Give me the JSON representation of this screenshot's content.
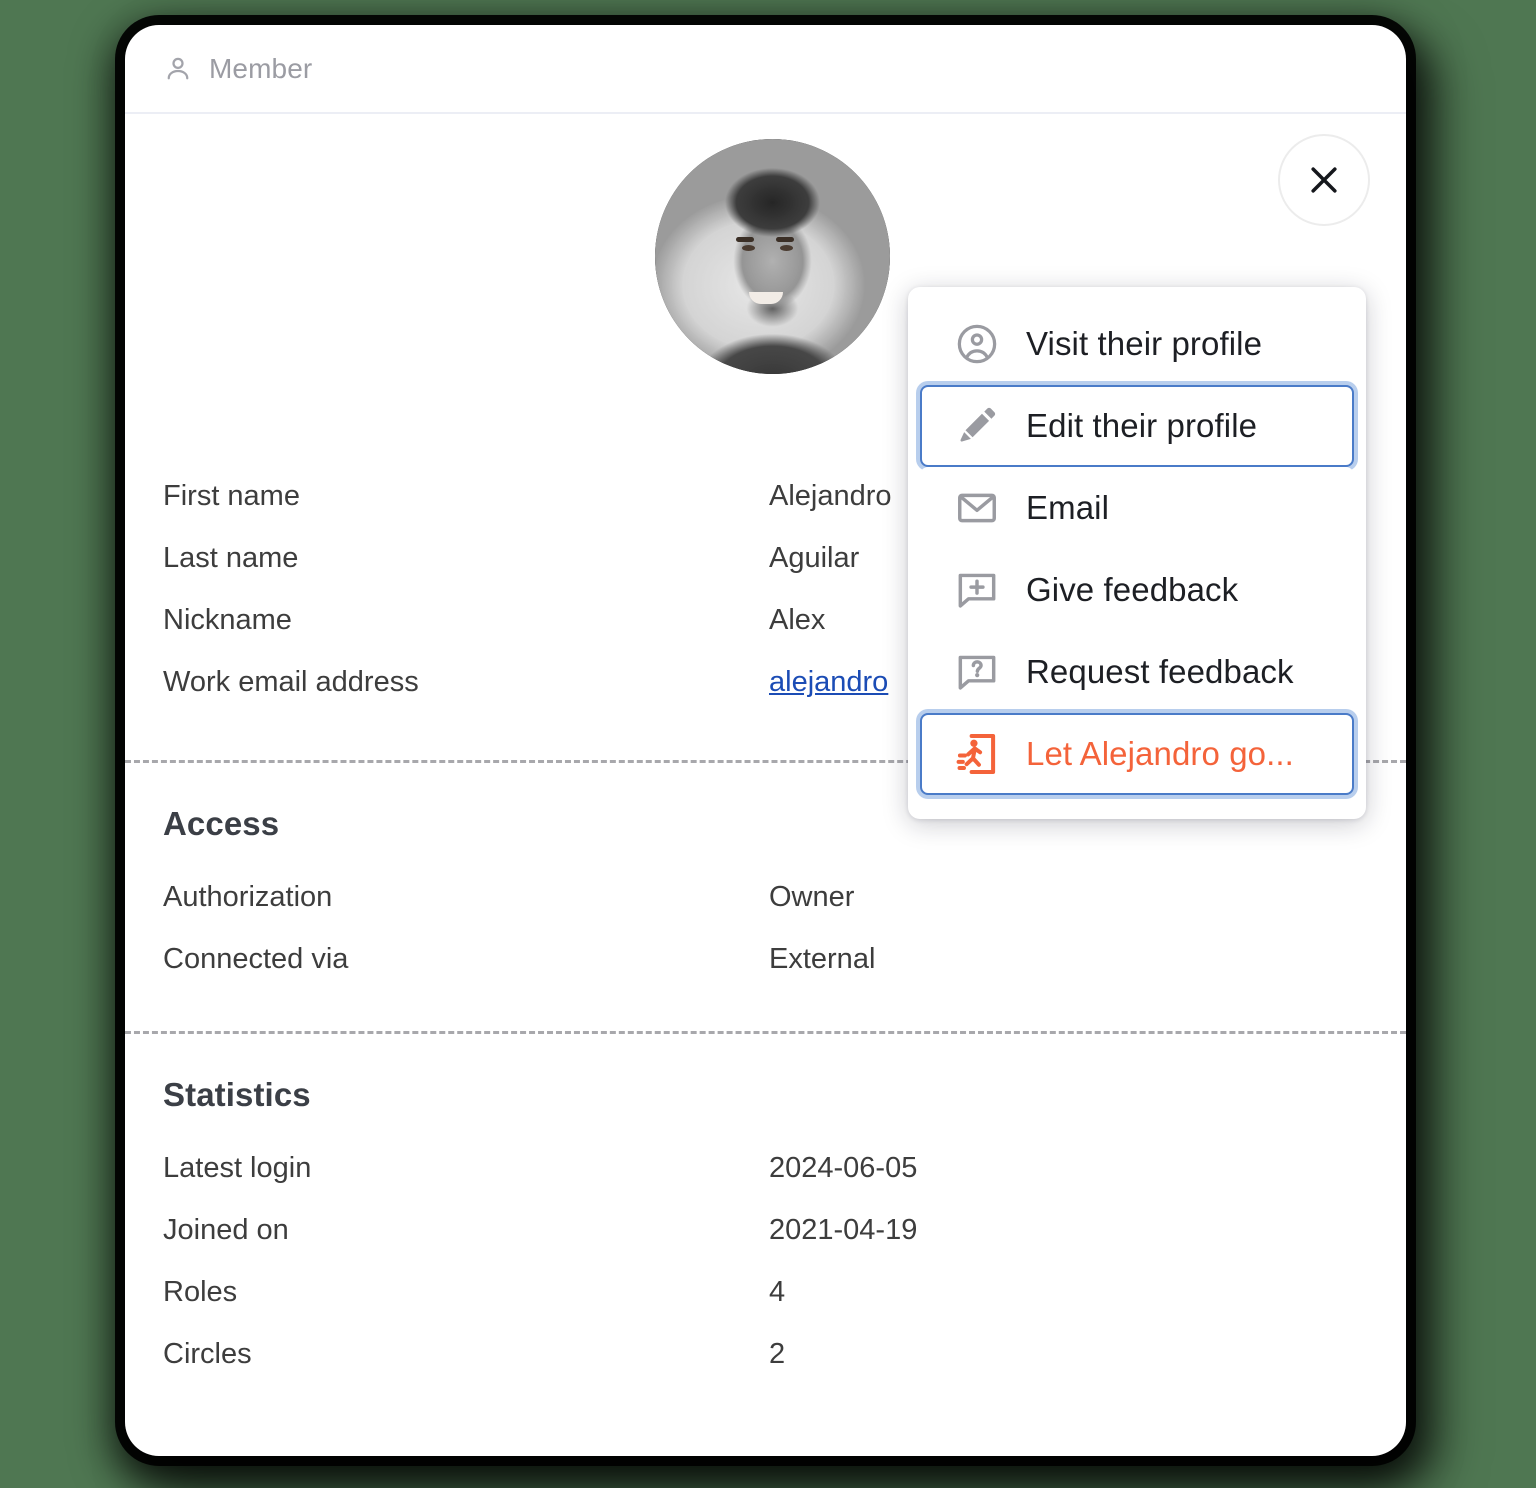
{
  "window": {
    "background_color": "#4f7752"
  },
  "header": {
    "icon": "person-icon",
    "title": "Member"
  },
  "avatar": {
    "alt": "member-avatar-photo"
  },
  "close_button": {
    "icon": "close-icon",
    "label": "Close"
  },
  "profile": {
    "fields": [
      {
        "label": "First name",
        "value": "Alejandro",
        "is_link": false
      },
      {
        "label": "Last name",
        "value": "Aguilar",
        "is_link": false
      },
      {
        "label": "Nickname",
        "value": "Alex",
        "is_link": false
      },
      {
        "label": "Work email address",
        "value": "alejandro",
        "is_link": true
      }
    ]
  },
  "access": {
    "title": "Access",
    "fields": [
      {
        "label": "Authorization",
        "value": "Owner"
      },
      {
        "label": "Connected via",
        "value": "External"
      }
    ]
  },
  "statistics": {
    "title": "Statistics",
    "fields": [
      {
        "label": "Latest login",
        "value": "2024-06-05"
      },
      {
        "label": "Joined on",
        "value": "2021-04-19"
      },
      {
        "label": "Roles",
        "value": "4"
      },
      {
        "label": "Circles",
        "value": "2"
      }
    ]
  },
  "action_menu": {
    "items": [
      {
        "label": "Visit their profile",
        "icon": "user-circle-icon",
        "focused": false,
        "danger": false
      },
      {
        "label": "Edit their profile",
        "icon": "pencil-icon",
        "focused": true,
        "danger": false
      },
      {
        "label": "Email",
        "icon": "envelope-icon",
        "focused": false,
        "danger": false
      },
      {
        "label": "Give feedback",
        "icon": "comment-plus-icon",
        "focused": false,
        "danger": false
      },
      {
        "label": "Request feedback",
        "icon": "comment-question-icon",
        "focused": false,
        "danger": false
      },
      {
        "label": "Let Alejandro go...",
        "icon": "exit-run-icon",
        "focused": true,
        "danger": true
      }
    ]
  },
  "colors": {
    "link": "#1b4cb5",
    "danger": "#f4633a",
    "focus_border": "#4a7bc8",
    "label_text": "#3d3d3d",
    "header_text": "#9b9ca3"
  }
}
